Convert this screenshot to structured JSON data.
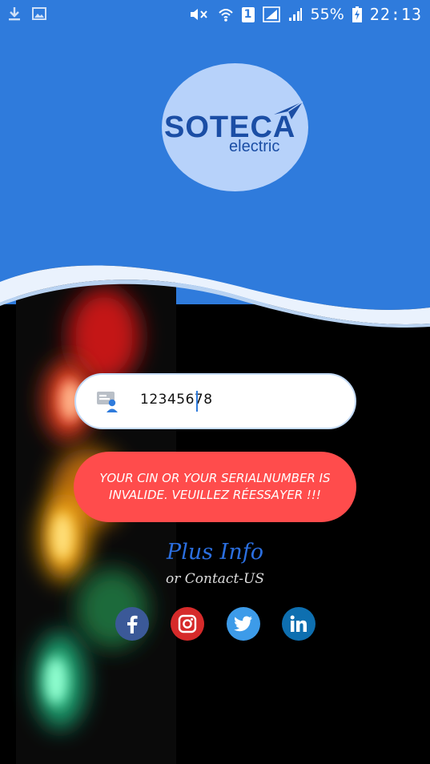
{
  "status_bar": {
    "battery_percent": "55%",
    "time": "22:13",
    "sim_slot": "1"
  },
  "logo": {
    "title": "SOTECA",
    "subtitle": "electric"
  },
  "input": {
    "value": "12345678"
  },
  "error": {
    "message": "YOUR CIN OR YOUR SERIALNUMBER IS INVALIDE. VEUILLEZ RÉESSAYER !!!"
  },
  "links": {
    "plus_info": "Plus Info",
    "contact": "or Contact-US"
  },
  "social": [
    "facebook-icon",
    "instagram-icon",
    "twitter-icon",
    "linkedin-icon"
  ],
  "colors": {
    "primary_blue": "#2f7bdc",
    "error_red": "#ff4c4c",
    "facebook": "#3b5998",
    "instagram": "#d62a2a",
    "twitter": "#3d9be9",
    "linkedin": "#0e6fb0"
  }
}
